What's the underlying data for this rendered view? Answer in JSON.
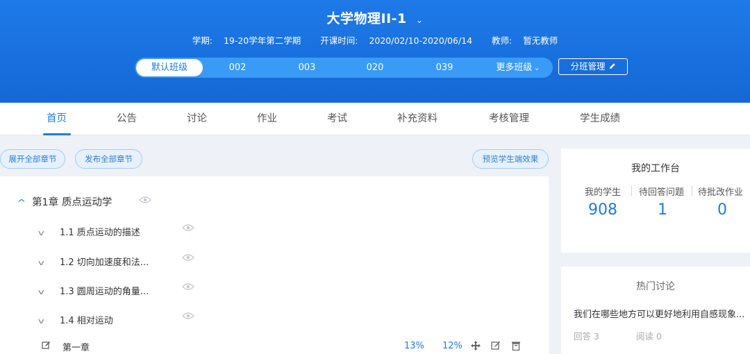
{
  "header": {
    "course_title": "大学物理II-1",
    "term_label": "学期:",
    "term_value": "19-20学年第二学期",
    "period_label": "开课时间:",
    "period_value": "2020/02/10-2020/06/14",
    "teacher_label": "教师:",
    "teacher_value": "暂无教师",
    "classes": [
      "默认班级",
      "002",
      "003",
      "020",
      "039"
    ],
    "more_classes": "更多班级",
    "manage_button": "分班管理"
  },
  "nav": {
    "tabs": [
      "首页",
      "公告",
      "讨论",
      "作业",
      "考试",
      "补充资料",
      "考核管理",
      "学生成绩"
    ],
    "active_index": 0
  },
  "toolbar": {
    "expand_all": "展开全部章节",
    "publish_all": "发布全部章节",
    "preview": "预览学生端效果"
  },
  "outline": {
    "chapter_title": "第1章 质点运动学",
    "sections": [
      "1.1 质点运动的描述",
      "1.2 切向加速度和法...",
      "1.3 圆周运动的角量...",
      "1.4 相对运动"
    ],
    "chapter_row": {
      "name": "第一章",
      "percent_a": "13%",
      "percent_b": "12%"
    }
  },
  "workbench": {
    "title": "我的工作台",
    "stats": [
      {
        "label": "我的学生",
        "value": "908"
      },
      {
        "label": "待回答问题",
        "value": "1"
      },
      {
        "label": "待批改作业",
        "value": "0"
      }
    ]
  },
  "hot_discussion": {
    "title": "热门讨论",
    "question": "我们在哪些地方可以更好地利用自感现象...",
    "answers": "回答 3",
    "reads": "阅读 0"
  },
  "colors": {
    "brand_blue": "#1e7ae8",
    "header_bar": "#3a9bf6"
  }
}
